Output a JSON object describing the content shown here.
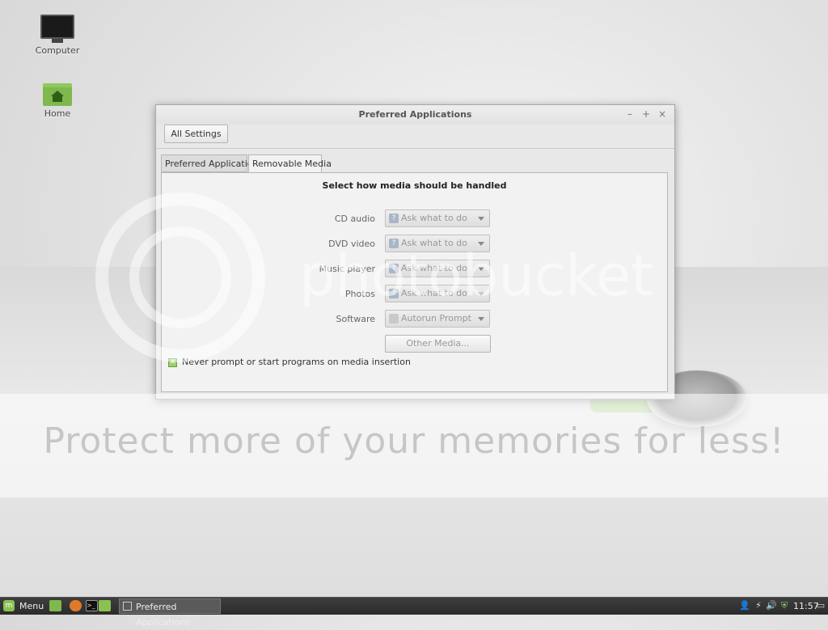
{
  "desktop": {
    "icons": [
      {
        "label": "Computer",
        "icon": "computer-icon"
      },
      {
        "label": "Home",
        "icon": "home-folder-icon"
      }
    ],
    "watermark": {
      "brand": "photobucket",
      "tagline": "Protect more of your memories for less!"
    }
  },
  "window": {
    "title": "Preferred Applications",
    "controls": {
      "minimize": "–",
      "maximize": "+",
      "close": "×"
    },
    "toolbar": {
      "all_settings": "All Settings"
    },
    "tabs": [
      {
        "label": "Preferred Applications",
        "active": false
      },
      {
        "label": "Removable Media",
        "active": true
      }
    ],
    "heading": "Select how media should be handled",
    "rows": [
      {
        "label": "CD audio",
        "value": "Ask what to do",
        "icon": "question-icon"
      },
      {
        "label": "DVD video",
        "value": "Ask what to do",
        "icon": "question-icon"
      },
      {
        "label": "Music player",
        "value": "Ask what to do",
        "icon": "question-icon"
      },
      {
        "label": "Photos",
        "value": "Ask what to do",
        "icon": "question-icon"
      },
      {
        "label": "Software",
        "value": "Autorun Prompt",
        "icon": "autorun-icon"
      }
    ],
    "other_media": "Other Media...",
    "never_prompt": {
      "label": "Never prompt or start programs on media insertion",
      "checked": true
    }
  },
  "taskbar": {
    "menu_label": "Menu",
    "launchers": [
      "show-desktop-icon",
      "firefox-icon",
      "terminal-icon",
      "files-icon"
    ],
    "task": "Preferred Applications",
    "tray": [
      "user-icon",
      "network-icon",
      "volume-icon",
      "shield-icon"
    ],
    "clock": "11:57",
    "tray_end": "display-icon"
  },
  "colors": {
    "mint_green": "#8cc152",
    "taskbar_bg": "#2b2b2b",
    "window_bg": "#e8e8e8"
  }
}
